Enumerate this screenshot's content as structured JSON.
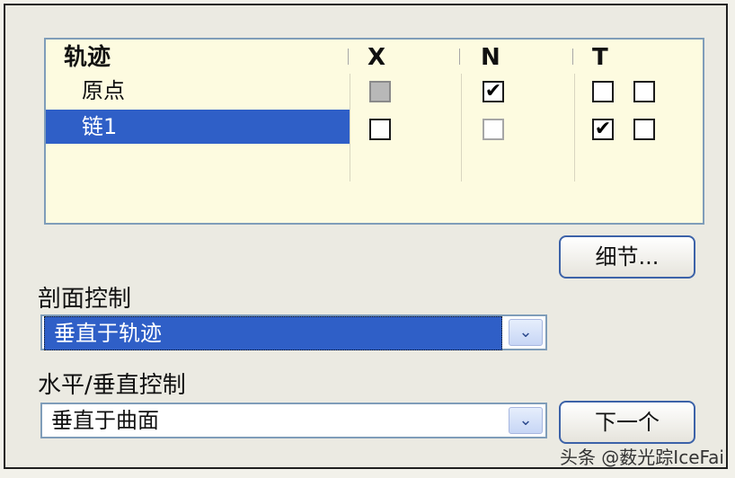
{
  "table": {
    "headers": [
      "轨迹",
      "X",
      "N",
      "T"
    ],
    "rows": [
      {
        "name": "原点",
        "x": "disabled-gray",
        "n": true,
        "t": [
          false,
          false
        ],
        "selected": false
      },
      {
        "name": "链1",
        "x": false,
        "n": "disabled",
        "t": [
          true,
          false
        ],
        "selected": true
      }
    ],
    "check_glyph": "✔"
  },
  "details_button": "细节...",
  "section_control": {
    "label": "剖面控制",
    "value": "垂直于轨迹"
  },
  "hv_control": {
    "label": "水平/垂直控制",
    "value": "垂直于曲面"
  },
  "next_button": "下一个",
  "dropdown_glyph": "⌄",
  "watermark": "头条 @薮光踪IceFai",
  "colors": {
    "selection": "#2f5fc7",
    "table_bg": "#fdfbe0",
    "border": "#7f9db9"
  }
}
